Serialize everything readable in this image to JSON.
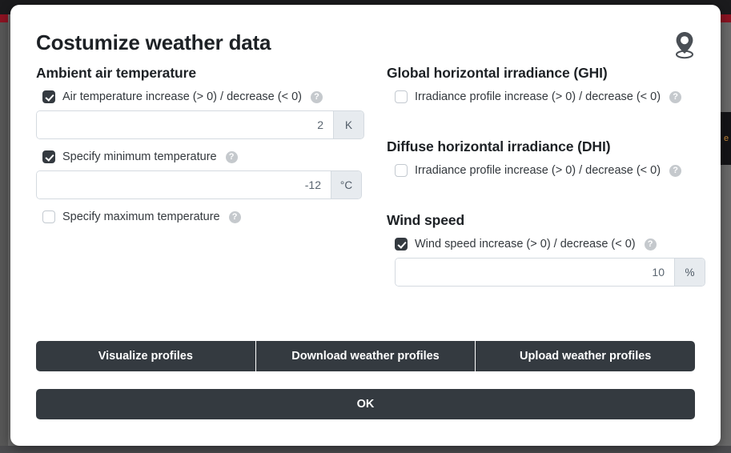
{
  "dialog": {
    "title": "Costumize weather data",
    "pin_icon": "location-pin-icon"
  },
  "colors": {
    "accent_dark": "#343a40",
    "accent_red": "#8c1322",
    "text": "#1d2125",
    "help": "#c5c9cd"
  },
  "backdrop": {
    "right_panel_text": "e"
  },
  "help_glyph": "?",
  "sections": {
    "ambient": {
      "title": "Ambient air temperature",
      "increase": {
        "label": "Air temperature increase (> 0) / decrease (< 0)",
        "checked": true,
        "value": "2",
        "unit": "K"
      },
      "minimum": {
        "label": "Specify minimum temperature",
        "checked": true,
        "value": "-12",
        "unit": "°C"
      },
      "maximum": {
        "label": "Specify maximum temperature",
        "checked": false
      }
    },
    "ghi": {
      "title": "Global horizontal irradiance (GHI)",
      "increase": {
        "label": "Irradiance profile increase (> 0) / decrease (< 0)",
        "checked": false
      }
    },
    "dhi": {
      "title": "Diffuse horizontal irradiance (DHI)",
      "increase": {
        "label": "Irradiance profile increase (> 0) / decrease (< 0)",
        "checked": false
      }
    },
    "wind": {
      "title": "Wind speed",
      "increase": {
        "label": "Wind speed increase (> 0) / decrease (< 0)",
        "checked": true,
        "value": "10",
        "unit": "%"
      }
    }
  },
  "footer": {
    "buttons": [
      {
        "label": "Visualize profiles"
      },
      {
        "label": "Download weather profiles"
      },
      {
        "label": "Upload weather profiles"
      }
    ],
    "ok_label": "OK"
  }
}
